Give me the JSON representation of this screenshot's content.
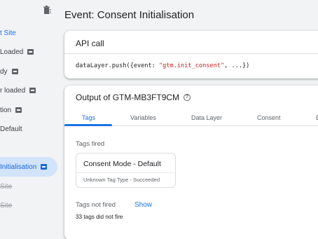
{
  "sidebar": {
    "items": [
      {
        "label": "t Site",
        "badge": false,
        "style": "link"
      },
      {
        "label": "Loaded",
        "badge": true,
        "style": "normal"
      },
      {
        "label": "dy",
        "badge": true,
        "style": "normal"
      },
      {
        "label": "r loaded",
        "badge": true,
        "style": "normal"
      },
      {
        "label": "tion",
        "badge": true,
        "style": "normal"
      },
      {
        "label": "Default",
        "badge": false,
        "style": "normal"
      },
      {
        "label": "Initialisation",
        "badge": true,
        "style": "active"
      },
      {
        "label": "Site",
        "badge": false,
        "style": "strike"
      },
      {
        "label": "Site",
        "badge": false,
        "style": "strike"
      }
    ]
  },
  "header": {
    "title": "Event: Consent Initialisation"
  },
  "api_call": {
    "title": "API call",
    "code_prefix": "dataLayer.push({event: ",
    "code_string": "\"gtm.init_consent\"",
    "code_suffix": ", ...})"
  },
  "output": {
    "title": "Output of GTM-MB3FT9CM",
    "tabs": [
      "Tags",
      "Variables",
      "Data Layer",
      "Consent",
      "E"
    ],
    "active_tab": "Tags",
    "tags_fired_label": "Tags fired",
    "fired_tags": [
      {
        "name": "Consent Mode - Default",
        "status": "Unknown Tag Type - Succeeded"
      }
    ],
    "tags_not_fired_label": "Tags not fired",
    "show_label": "Show",
    "not_fired_count_text": "33 tags did not fire"
  },
  "colors": {
    "accent": "#1a73e8",
    "active_bg": "#d2e3fc",
    "page_bg": "#f1f3f4"
  }
}
